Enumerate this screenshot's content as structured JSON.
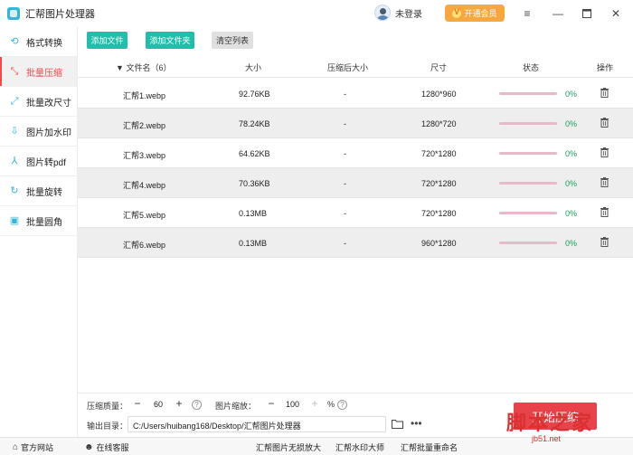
{
  "window": {
    "title": "汇帮图片处理器",
    "user_label": "未登录",
    "vip_label": "开通会员"
  },
  "sidebar": {
    "items": [
      {
        "label": "格式转换",
        "icon": "refresh-icon"
      },
      {
        "label": "批量压缩",
        "icon": "compress-icon",
        "active": true
      },
      {
        "label": "批量改尺寸",
        "icon": "resize-icon"
      },
      {
        "label": "图片加水印",
        "icon": "watermark-icon"
      },
      {
        "label": "图片转pdf",
        "icon": "pdf-icon"
      },
      {
        "label": "批量旋转",
        "icon": "rotate-icon"
      },
      {
        "label": "批量圆角",
        "icon": "round-corner-icon"
      }
    ]
  },
  "toolbar": {
    "add_file": "添加文件",
    "add_folder": "添加文件夹",
    "clear_list": "清空列表"
  },
  "table": {
    "columns": {
      "name": "文件名（6）",
      "size": "大小",
      "compressed": "压缩后大小",
      "dimensions": "尺寸",
      "status": "状态",
      "action": "操作"
    },
    "rows": [
      {
        "name": "汇帮1.webp",
        "size": "92.76KB",
        "compressed": "-",
        "dimensions": "1280*960",
        "progress": "0%"
      },
      {
        "name": "汇帮2.webp",
        "size": "78.24KB",
        "compressed": "-",
        "dimensions": "1280*720",
        "progress": "0%"
      },
      {
        "name": "汇帮3.webp",
        "size": "64.62KB",
        "compressed": "-",
        "dimensions": "720*1280",
        "progress": "0%"
      },
      {
        "name": "汇帮4.webp",
        "size": "70.36KB",
        "compressed": "-",
        "dimensions": "720*1280",
        "progress": "0%"
      },
      {
        "name": "汇帮5.webp",
        "size": "0.13MB",
        "compressed": "-",
        "dimensions": "720*1280",
        "progress": "0%"
      },
      {
        "name": "汇帮6.webp",
        "size": "0.13MB",
        "compressed": "-",
        "dimensions": "960*1280",
        "progress": "0%"
      }
    ]
  },
  "controls": {
    "quality_label": "压缩质量：",
    "quality_value": "60",
    "scale_label": "图片缩放：",
    "scale_value": "100",
    "scale_unit": "%",
    "output_label": "输出目录：",
    "output_path": "C:/Users/huibang168/Desktop/汇帮图片处理器",
    "start_label": "开始压缩"
  },
  "statusbar": {
    "website": "官方网站",
    "support": "在线客服",
    "link1": "汇帮图片无损放大",
    "link2": "汇帮水印大师",
    "link3": "汇帮批量重命名"
  },
  "watermark": {
    "text": "脚本之家",
    "url": "jb51.net"
  },
  "colors": {
    "accent_teal": "#1fbfab",
    "active_red": "#f04a4a",
    "start_red": "#e8434a",
    "vip_orange": "#f7a73e",
    "progress_track": "#e8b9c6",
    "percent_green": "#1aa05a"
  }
}
